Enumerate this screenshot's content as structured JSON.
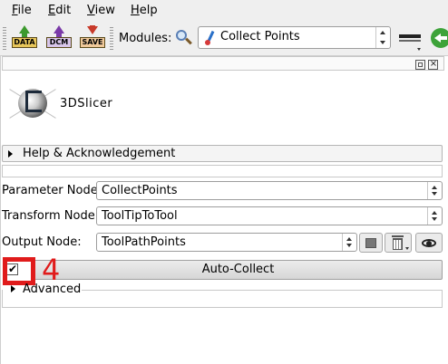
{
  "menu": {
    "items": [
      {
        "accel": "F",
        "rest": "ile"
      },
      {
        "accel": "E",
        "rest": "dit"
      },
      {
        "accel": "V",
        "rest": "iew"
      },
      {
        "accel": "H",
        "rest": "elp"
      }
    ]
  },
  "toolbar": {
    "data_label": "DATA",
    "dcm_label": "DCM",
    "save_label": "SAVE",
    "modules_label": "Modules:",
    "module_selected": "Collect Points"
  },
  "logo": {
    "text": "3DSlicer"
  },
  "help_section": {
    "label": "Help & Acknowledgement"
  },
  "form": {
    "parameter_node": {
      "label": "Parameter Node:",
      "value": "CollectPoints"
    },
    "transform_node": {
      "label": "Transform Node:",
      "value": "ToolTipToTool"
    },
    "output_node": {
      "label": "Output Node:",
      "value": "ToolPathPoints"
    }
  },
  "auto_collect": {
    "checked": true,
    "check_glyph": "✔",
    "label": "Auto-Collect"
  },
  "annotation": {
    "number": "4",
    "color": "#e01b1b"
  },
  "advanced": {
    "label": "Advanced"
  },
  "colors": {
    "accent_green": "#3da339",
    "highlight_red": "#e01b1b",
    "toolbar_bg": "#efefef"
  }
}
